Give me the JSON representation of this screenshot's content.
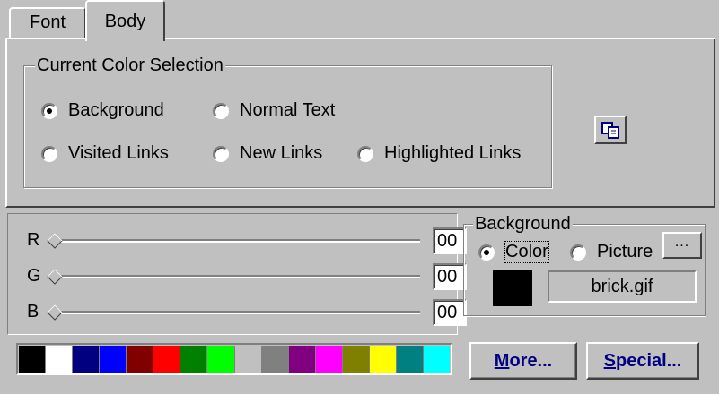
{
  "tabs": [
    {
      "label": "Font",
      "active": false
    },
    {
      "label": "Body",
      "active": true
    }
  ],
  "color_selection": {
    "title": "Current Color Selection",
    "options": [
      {
        "label": "Background",
        "checked": true
      },
      {
        "label": "Normal Text",
        "checked": false
      },
      {
        "label": "Visited Links",
        "checked": false
      },
      {
        "label": "New Links",
        "checked": false
      },
      {
        "label": "Highlighted Links",
        "checked": false
      }
    ],
    "copy_icon": "copy-icon"
  },
  "sliders": [
    {
      "label": "R",
      "value": "00"
    },
    {
      "label": "G",
      "value": "00"
    },
    {
      "label": "B",
      "value": "00"
    }
  ],
  "palette": [
    "#000000",
    "#ffffff",
    "#000080",
    "#0000ff",
    "#800000",
    "#ff0000",
    "#008000",
    "#00ff00",
    "#c0c0c0",
    "#808080",
    "#800080",
    "#ff00ff",
    "#808000",
    "#ffff00",
    "#008080",
    "#00ffff"
  ],
  "background_group": {
    "title": "Background",
    "color_option": {
      "label": "Color",
      "checked": true
    },
    "picture_option": {
      "label": "Picture",
      "checked": false
    },
    "browse_label": "...",
    "preview_color": "#000000",
    "filename": "brick.gif"
  },
  "buttons": {
    "more": {
      "mnemonic": "M",
      "rest": "ore..."
    },
    "special": {
      "mnemonic": "S",
      "rest": "pecial..."
    }
  }
}
